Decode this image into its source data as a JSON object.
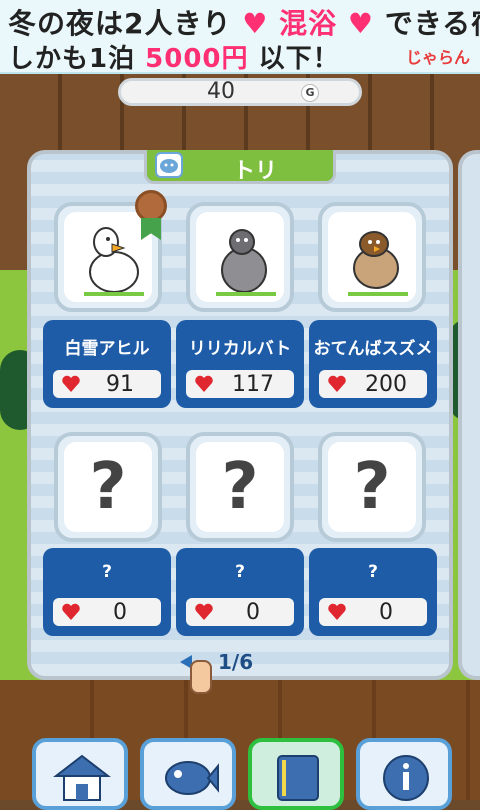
{
  "ad": {
    "line1_a": "冬の夜は2人きり",
    "line1_b": "混浴",
    "line1_c": "できる宿",
    "line2_a": "しかも1泊",
    "line2_b": "5000円",
    "line2_c": "以下！",
    "logo": "じゃらん"
  },
  "coins": {
    "value": "40",
    "unit": "G"
  },
  "panel": {
    "title": "トリ"
  },
  "birds": [
    {
      "name": "白雪アヒル",
      "hearts": "91"
    },
    {
      "name": "リリカルバト",
      "hearts": "117"
    },
    {
      "name": "おてんばスズメ",
      "hearts": "200"
    },
    {
      "name": "?",
      "hearts": "0"
    },
    {
      "name": "?",
      "hearts": "0"
    },
    {
      "name": "?",
      "hearts": "0"
    }
  ],
  "unknown_mark": "?",
  "pager": {
    "text": "1/6"
  },
  "nav": [
    "house-icon",
    "fish-icon",
    "book-icon",
    "info-icon"
  ],
  "colors": {
    "info_bg": "#1f5ca8",
    "heart": "#e0262e",
    "header_green": "#7fbf3f"
  }
}
